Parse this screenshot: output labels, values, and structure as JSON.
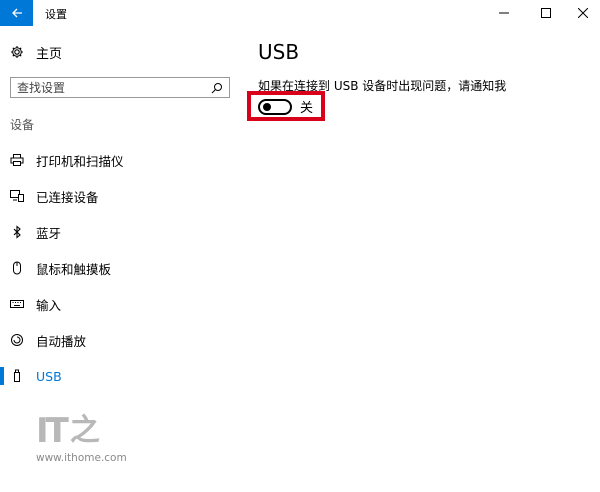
{
  "window": {
    "title": "设置"
  },
  "sidebar": {
    "home_label": "主页",
    "search_placeholder": "查找设置",
    "section_label": "设备",
    "items": [
      {
        "label": "打印机和扫描仪",
        "icon": "printer-icon"
      },
      {
        "label": "已连接设备",
        "icon": "devices-icon"
      },
      {
        "label": "蓝牙",
        "icon": "bluetooth-icon"
      },
      {
        "label": "鼠标和触摸板",
        "icon": "mouse-icon"
      },
      {
        "label": "输入",
        "icon": "keyboard-icon"
      },
      {
        "label": "自动播放",
        "icon": "autoplay-icon"
      },
      {
        "label": "USB",
        "icon": "usb-icon",
        "active": true
      }
    ]
  },
  "main": {
    "title": "USB",
    "description": "如果在连接到 USB 设备时出现问题，请通知我",
    "toggle_state": "关",
    "toggle_on": false
  },
  "watermark": {
    "logo_text": "IT",
    "logo_char": "之",
    "url": "www.ithome.com"
  },
  "colors": {
    "accent": "#0078d7",
    "highlight_border": "#d9001b"
  }
}
